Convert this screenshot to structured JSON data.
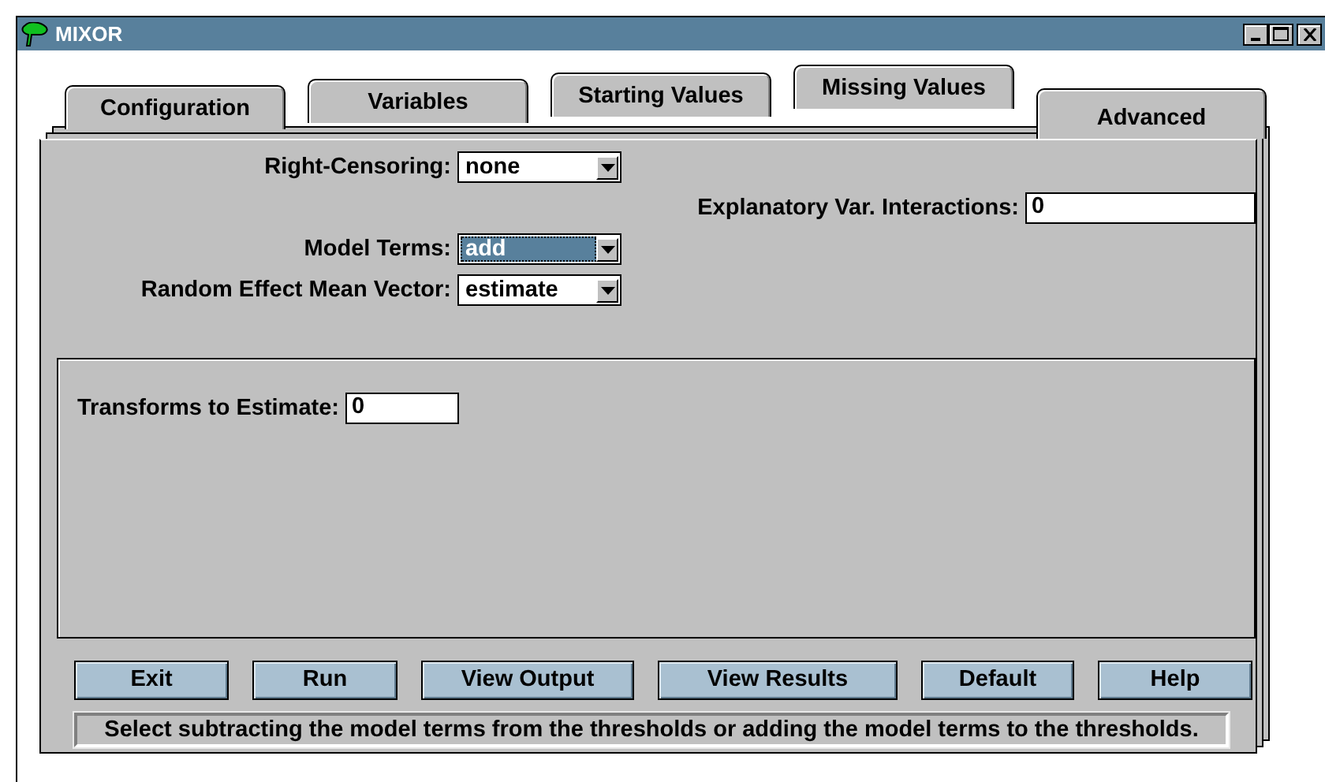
{
  "window": {
    "title": "MIXOR"
  },
  "tabs": [
    {
      "label": "Configuration",
      "selected": false
    },
    {
      "label": "Variables",
      "selected": false
    },
    {
      "label": "Starting Values",
      "selected": false
    },
    {
      "label": "Missing Values",
      "selected": false
    },
    {
      "label": "Advanced",
      "selected": true
    }
  ],
  "fields": [
    {
      "kind": "dropdown",
      "label": "Right-Censoring:",
      "value": "none",
      "focused": false
    },
    {
      "kind": "text",
      "label": "Explanatory Var. Interactions:",
      "value": "0"
    },
    {
      "kind": "dropdown",
      "label": "Model Terms:",
      "value": "add",
      "focused": true
    },
    {
      "kind": "dropdown",
      "label": "Random Effect Mean Vector:",
      "value": "estimate",
      "focused": false
    }
  ],
  "transforms": {
    "label": "Transforms to Estimate:",
    "value": "0"
  },
  "buttons": [
    {
      "label": "Exit"
    },
    {
      "label": "Run"
    },
    {
      "label": "View Output"
    },
    {
      "label": "View Results"
    },
    {
      "label": "Default"
    },
    {
      "label": "Help"
    }
  ],
  "status_message": "Select subtracting the model terms from the thresholds or adding the model terms to the thresholds."
}
